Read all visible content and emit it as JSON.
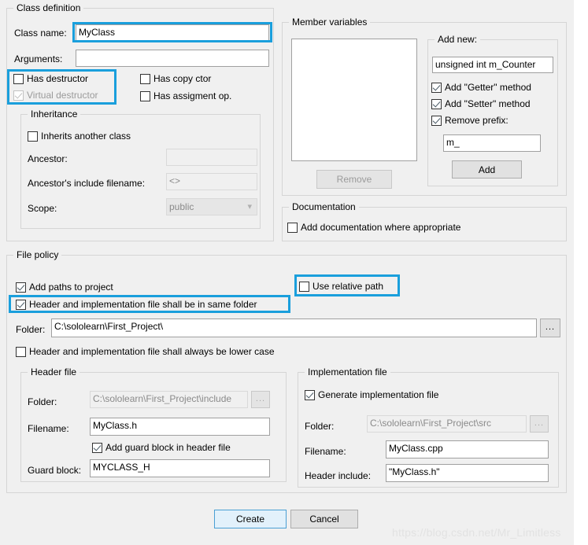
{
  "dialog": {
    "class_definition": {
      "title": "Class definition",
      "class_name_label": "Class name:",
      "class_name_value": "MyClass",
      "arguments_label": "Arguments:",
      "arguments_value": "",
      "has_destructor": "Has destructor",
      "virtual_destructor": "Virtual destructor",
      "has_copy_ctor": "Has copy ctor",
      "has_assigment_op": "Has assigment op.",
      "inheritance": {
        "title": "Inheritance",
        "inherits_another_class": "Inherits another class",
        "ancestor_label": "Ancestor:",
        "ancestor_value": "",
        "ancestor_include_label": "Ancestor's include filename:",
        "ancestor_include_value": "<>",
        "scope_label": "Scope:",
        "scope_value": "public"
      }
    },
    "member_variables": {
      "title": "Member variables",
      "list_items": [],
      "remove_label": "Remove",
      "add_new": {
        "title": "Add new:",
        "variable_value": "unsigned int m_Counter",
        "add_getter": "Add \"Getter\" method",
        "add_setter": "Add \"Setter\" method",
        "remove_prefix": "Remove prefix:",
        "prefix_value": "m_",
        "add_label": "Add"
      }
    },
    "documentation": {
      "title": "Documentation",
      "add_documentation": "Add documentation where appropriate"
    },
    "file_policy": {
      "title": "File policy",
      "add_paths_to_project": "Add paths to project",
      "use_relative_path": "Use relative path",
      "same_folder": "Header and implementation file shall be in same folder",
      "folder_label": "Folder:",
      "folder_value": "C:\\sololearn\\First_Project\\",
      "browse_label": "...",
      "lower_case": "Header and implementation file shall always be lower case",
      "header_file": {
        "title": "Header file",
        "folder_label": "Folder:",
        "folder_value": "C:\\sololearn\\First_Project\\include",
        "browse_label": "...",
        "filename_label": "Filename:",
        "filename_value": "MyClass.h",
        "add_guard_block": "Add guard block in header file",
        "guard_block_label": "Guard block:",
        "guard_block_value": "MYCLASS_H"
      },
      "implementation_file": {
        "title": "Implementation file",
        "generate_impl": "Generate implementation file",
        "folder_label": "Folder:",
        "folder_value": "C:\\sololearn\\First_Project\\src",
        "browse_label": "...",
        "filename_label": "Filename:",
        "filename_value": "MyClass.cpp",
        "header_include_label": "Header include:",
        "header_include_value": "\"MyClass.h\""
      }
    },
    "footer": {
      "create_label": "Create",
      "cancel_label": "Cancel"
    },
    "watermark": "https://blog.csdn.net/Mr_Limitless",
    "colors": {
      "highlight": "#1a9fdc",
      "dialog_bg": "#f0f0f0",
      "default_button": "#e2f1fb"
    }
  }
}
